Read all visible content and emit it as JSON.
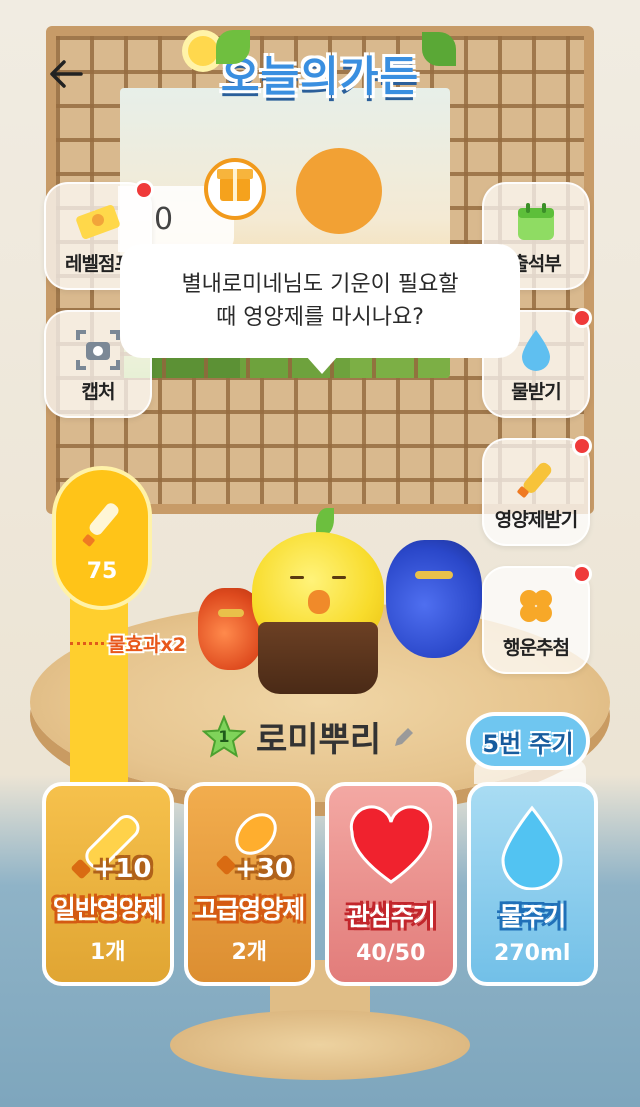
{
  "header": {
    "title": "오늘의가든",
    "back_label": "←"
  },
  "left_buttons": [
    {
      "label": "레벨점프",
      "icon": "ticket-clover-icon",
      "badge": true
    },
    {
      "label": "캡처",
      "icon": "camera-icon",
      "badge": false
    }
  ],
  "level_counter": "0",
  "right_buttons": [
    {
      "label": "출석부",
      "icon": "calendar-icon",
      "badge": false
    },
    {
      "label": "물받기",
      "icon": "water-drop-icon",
      "badge": true
    },
    {
      "label": "영양제받기",
      "icon": "nutrient-bottle-icon",
      "badge": true
    },
    {
      "label": "행운추첨",
      "icon": "clover-icon",
      "badge": true
    }
  ],
  "speech": {
    "line1": "별내로미네님도 기운이 필요할",
    "line2": "때 영양제를 마시나요?"
  },
  "gauge": {
    "value": "75",
    "marker_label": "물효과x2"
  },
  "plant": {
    "level": "1",
    "name": "로미뿌리"
  },
  "water_badge": "5번 주기",
  "cards": [
    {
      "title": "일반영양제",
      "sub": "1개",
      "bonus": "+10",
      "icon": "nutrient-bottle-icon"
    },
    {
      "title": "고급영양제",
      "sub": "2개",
      "bonus": "+30",
      "icon": "premium-nutrient-bottle-icon"
    },
    {
      "title": "관심주기",
      "sub": "40/50",
      "bonus": "",
      "icon": "heart-icon"
    },
    {
      "title": "물주기",
      "sub": "270ml",
      "bonus": "",
      "icon": "water-drop-icon"
    }
  ],
  "colors": {
    "accent_blue": "#3a8fe0",
    "badge_red": "#ef3a3a",
    "gauge_yellow": "#ffc418",
    "marker_orange": "#e8571a"
  }
}
